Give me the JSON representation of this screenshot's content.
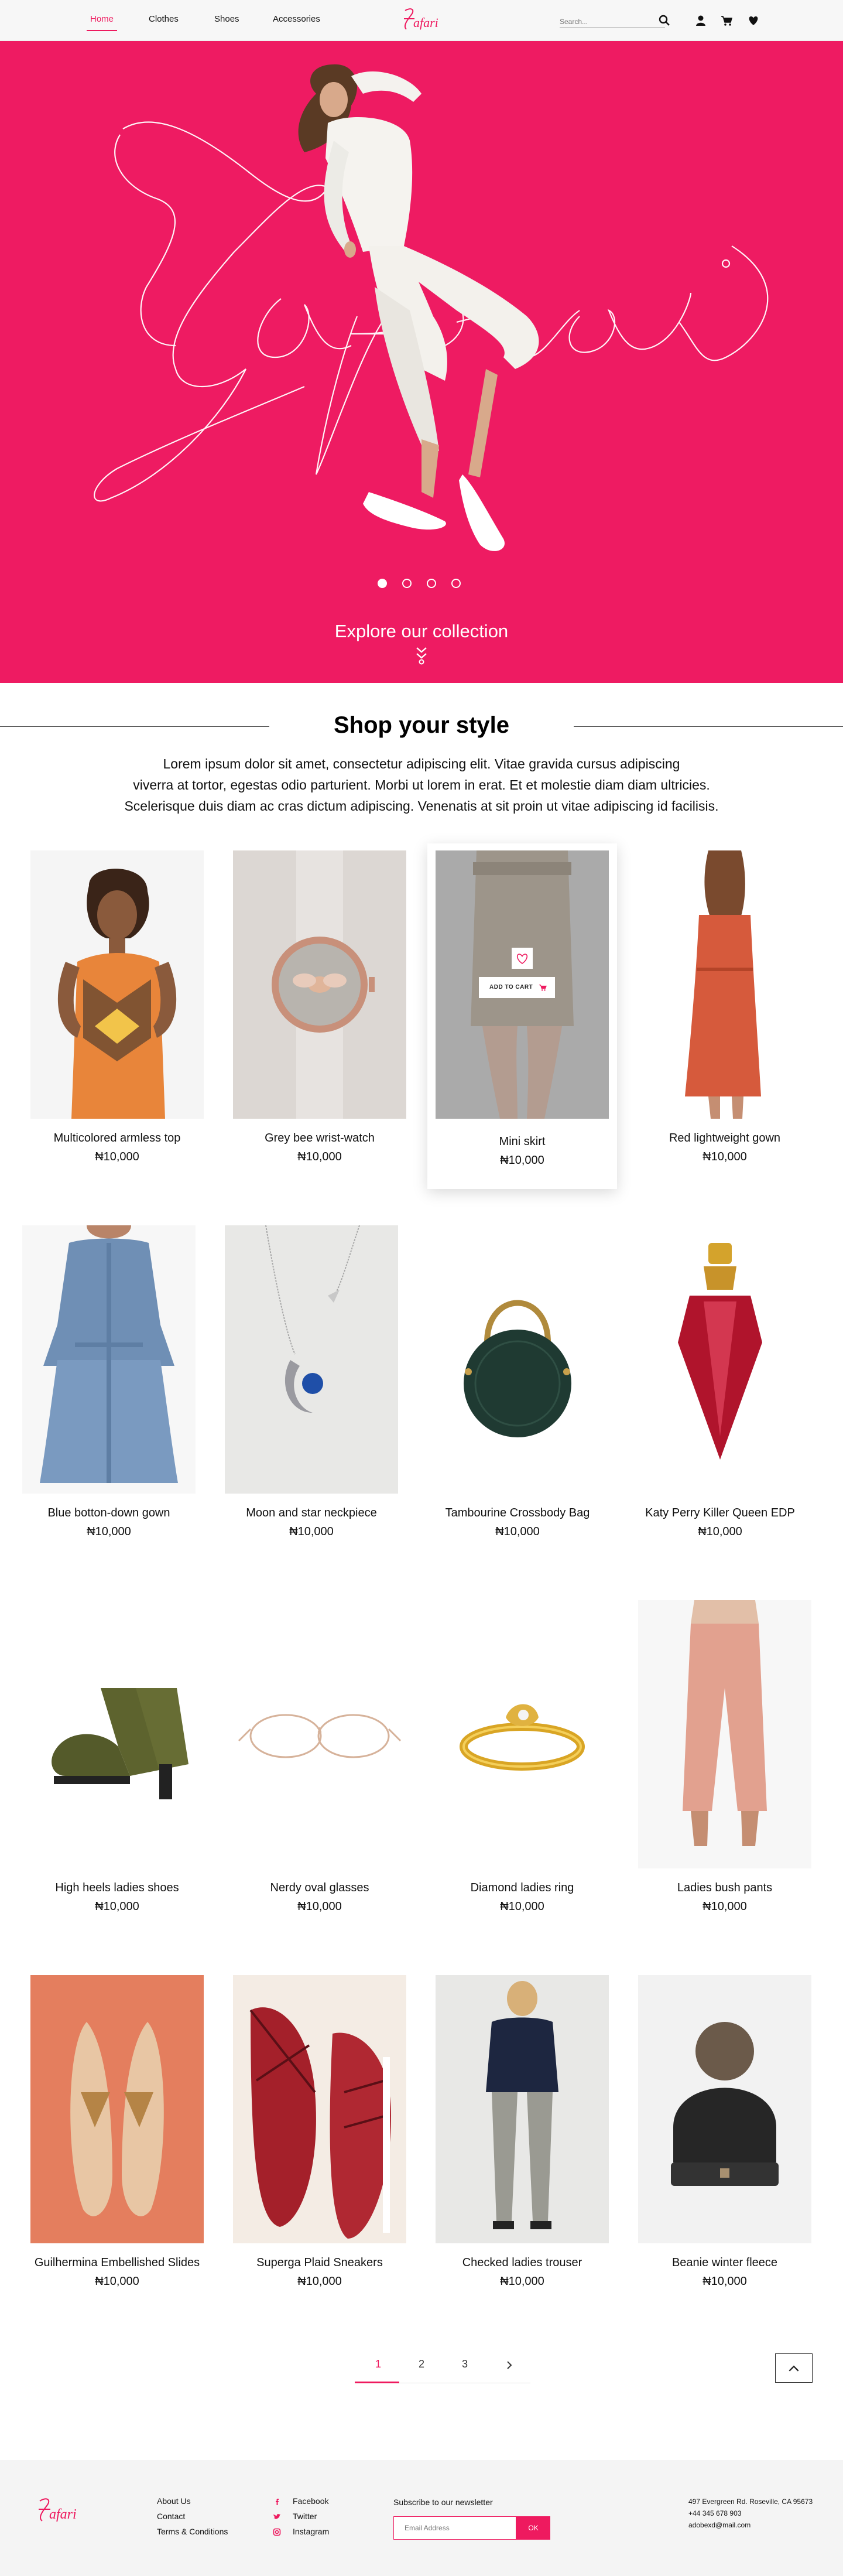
{
  "brand": {
    "name": "Zafari",
    "accent": "#ee1a5f"
  },
  "nav": {
    "links": [
      "Home",
      "Clothes",
      "Shoes",
      "Accessories"
    ],
    "search_placeholder": "Search...",
    "icons": [
      "search-icon",
      "user-icon",
      "cart-icon",
      "heart-icon"
    ]
  },
  "hero": {
    "background": "#ee1b62",
    "slides_count": 4,
    "active_slide": 1,
    "cta": "Explore our collection"
  },
  "shop": {
    "title": "Shop your style",
    "intro": [
      "Lorem ipsum dolor sit amet, consectetur adipiscing elit. Vitae gravida cursus adipiscing",
      "viverra at tortor, egestas odio parturient. Morbi ut lorem in erat. Et et molestie diam diam ultricies.",
      "Scelerisque duis diam ac cras dictum adipiscing. Venenatis at sit proin ut vitae adipiscing id facilisis."
    ],
    "add_to_cart": "ADD TO CART",
    "products": [
      {
        "name": "Multicolored armless top",
        "price": "₦10,000"
      },
      {
        "name": "Grey bee wrist-watch",
        "price": "₦10,000"
      },
      {
        "name": "Mini skirt",
        "price": "₦10,000"
      },
      {
        "name": "Red lightweight gown",
        "price": "₦10,000"
      },
      {
        "name": "Blue botton-down gown",
        "price": "₦10,000"
      },
      {
        "name": "Moon and star neckpiece",
        "price": "₦10,000"
      },
      {
        "name": "Tambourine Crossbody Bag",
        "price": "₦10,000"
      },
      {
        "name": "Katy Perry Killer Queen EDP",
        "price": "₦10,000"
      },
      {
        "name": "High heels ladies shoes",
        "price": "₦10,000"
      },
      {
        "name": "Nerdy oval glasses",
        "price": "₦10,000"
      },
      {
        "name": "Diamond ladies ring",
        "price": "₦10,000"
      },
      {
        "name": "Ladies bush pants",
        "price": "₦10,000"
      },
      {
        "name": "Guilhermina Embellished Slides",
        "price": "₦10,000"
      },
      {
        "name": "Superga Plaid Sneakers",
        "price": "₦10,000"
      },
      {
        "name": "Checked ladies trouser",
        "price": "₦10,000"
      },
      {
        "name": "Beanie winter fleece",
        "price": "₦10,000"
      }
    ]
  },
  "pagination": {
    "pages": [
      "1",
      "2",
      "3"
    ],
    "current": "1"
  },
  "footer": {
    "links": [
      "About Us",
      "Contact",
      "Terms & Conditions"
    ],
    "social": [
      "Facebook",
      "Twitter",
      "Instagram"
    ],
    "newsletter_label": "Subscribe to our newsletter",
    "email_placeholder": "Email Address",
    "ok": "OK",
    "address": [
      "497 Evergreen Rd. Roseville, CA 95673",
      "+44 345 678 903",
      "adobexd@mail.com"
    ]
  }
}
